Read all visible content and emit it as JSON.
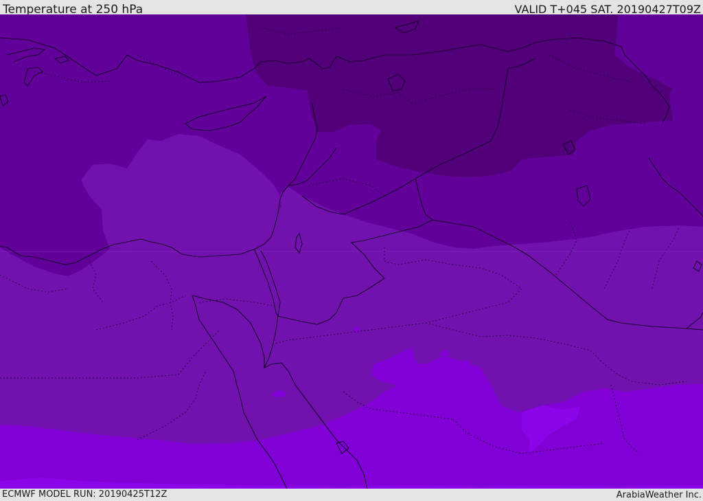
{
  "header": {
    "title": "Temperature at 250 hPa",
    "valid_time": "VALID T+045 SAT. 20190427T09Z"
  },
  "footer": {
    "model_run": "ECMWF MODEL RUN: 20190425T12Z",
    "credit": "ArabiaWeather Inc."
  },
  "palette": {
    "coldest": "#52007a",
    "colder": "#62009a",
    "mid": "#7212ae",
    "warmer": "#8000d6",
    "warmest": "#8a05ea",
    "coastline": "#1a0030",
    "background": "#e4e4e4"
  }
}
